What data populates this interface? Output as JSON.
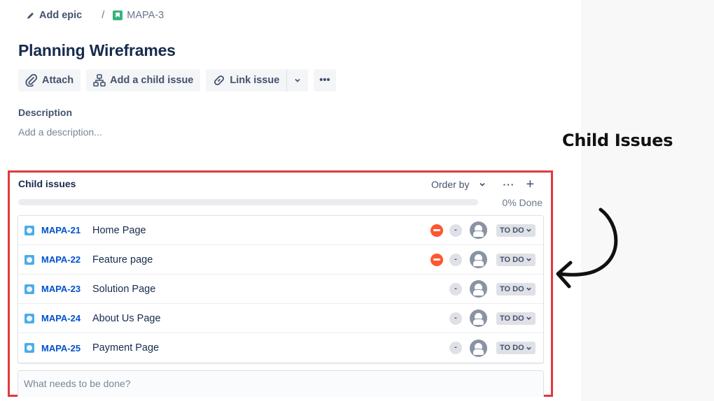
{
  "breadcrumb": {
    "add_epic": "Add epic",
    "separator": "/",
    "parent_key": "MAPA-3"
  },
  "issue": {
    "title": "Planning Wireframes"
  },
  "toolbar": {
    "attach": "Attach",
    "add_child": "Add a child issue",
    "link_issue": "Link issue",
    "more": "•••"
  },
  "description": {
    "label": "Description",
    "placeholder": "Add a description..."
  },
  "child_issues": {
    "title": "Child issues",
    "order_by": "Order by",
    "more": "···",
    "add": "+",
    "progress_percent": 0,
    "progress_label": "0% Done",
    "items": [
      {
        "key": "MAPA-21",
        "summary": "Home Page",
        "priority": "highest",
        "estimate": "-",
        "status": "TO DO"
      },
      {
        "key": "MAPA-22",
        "summary": "Feature page",
        "priority": "highest",
        "estimate": "-",
        "status": "TO DO"
      },
      {
        "key": "MAPA-23",
        "summary": "Solution Page",
        "priority": null,
        "estimate": "-",
        "status": "TO DO"
      },
      {
        "key": "MAPA-24",
        "summary": "About Us Page",
        "priority": null,
        "estimate": "-",
        "status": "TO DO"
      },
      {
        "key": "MAPA-25",
        "summary": "Payment Page",
        "priority": null,
        "estimate": "-",
        "status": "TO DO"
      }
    ],
    "new_placeholder": "What needs to be done?"
  },
  "annotation": {
    "label": "Child Issues",
    "highlight_color": "#e0393e"
  }
}
